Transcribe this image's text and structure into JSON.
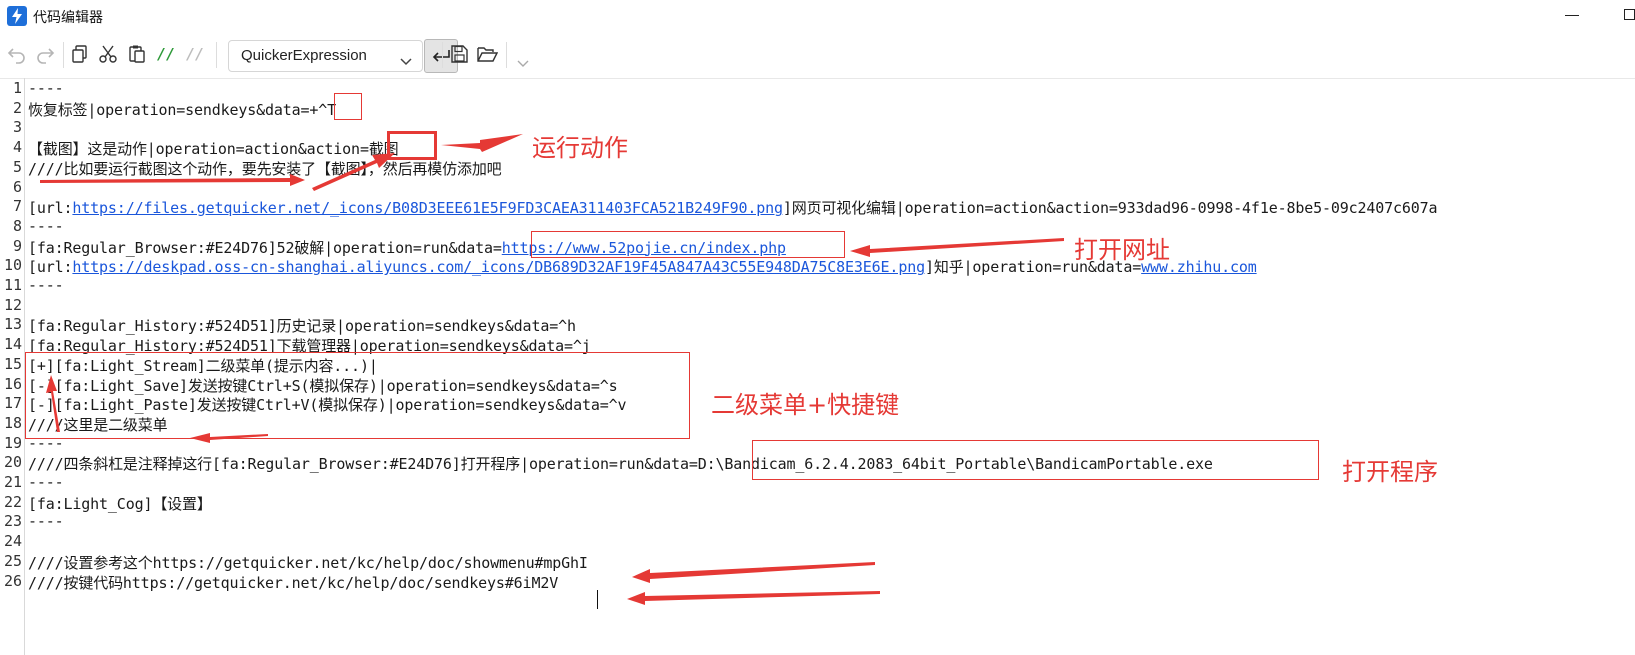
{
  "window": {
    "title": "代码编辑器"
  },
  "toolbar": {
    "buttons": [
      "undo-icon",
      "redo-icon",
      "copy-icon",
      "cut-icon",
      "paste-icon",
      "comment-icon",
      "uncomment-icon",
      "word-wrap-icon",
      "save-icon",
      "open-folder-icon",
      "chevron-down-icon"
    ],
    "comment_glyph": "//",
    "uncomment_glyph": "//",
    "language_select": {
      "value": "QuickerExpression"
    }
  },
  "editor": {
    "line_numbers": [
      "1",
      "2",
      "3",
      "4",
      "5",
      "6",
      "7",
      "8",
      "9",
      "10",
      "11",
      "12",
      "13",
      "14",
      "15",
      "16",
      "17",
      "18",
      "19",
      "20",
      "21",
      "22",
      "23",
      "24",
      "25",
      "26"
    ],
    "lines": [
      {
        "text": "----"
      },
      {
        "text": "恢复标签|operation=sendkeys&data=+^T"
      },
      {
        "text": ""
      },
      {
        "text": "【截图】这是动作|operation=action&action=截图"
      },
      {
        "text": "////比如要运行截图这个动作，要先安装了【截图】，然后再模仿添加吧"
      },
      {
        "text": ""
      },
      {
        "pre": "[url:",
        "link": "https://files.getquicker.net/_icons/B08D3EEE61E5F9FD3CAEA311403FCA521B249F90.png",
        "post": "]网页可视化编辑|operation=action&action=933dad96-0998-4f1e-8be5-09c2407c607a"
      },
      {
        "text": "----"
      },
      {
        "pre": "[fa:Regular_Browser:#E24D76]52破解|operation=run&data=",
        "link": "https://www.52pojie.cn/index.php",
        "post": ""
      },
      {
        "pre": "[url:",
        "link": "https://deskpad.oss-cn-shanghai.aliyuncs.com/_icons/DB689D32AF19F45A847A43C55E948DA75C8E3E6E.png",
        "post": "]知乎|operation=run&data=",
        "link2": "www.zhihu.com"
      },
      {
        "text": "----"
      },
      {
        "text": ""
      },
      {
        "text": "[fa:Regular_History:#524D51]历史记录|operation=sendkeys&data=^h"
      },
      {
        "text": "[fa:Regular_History:#524D51]下载管理器|operation=sendkeys&data=^j"
      },
      {
        "text": "[+][fa:Light_Stream]二级菜单(提示内容...)|"
      },
      {
        "text": "[-][fa:Light_Save]发送按键Ctrl+S(模拟保存)|operation=sendkeys&data=^s"
      },
      {
        "text": "[-][fa:Light_Paste]发送按键Ctrl+V(模拟保存)|operation=sendkeys&data=^v"
      },
      {
        "text": "////这里是二级菜单"
      },
      {
        "text": "----"
      },
      {
        "text": "////四条斜杠是注释掉这行[fa:Regular_Browser:#E24D76]打开程序|operation=run&data=D:\\Bandicam_6.2.4.2083_64bit_Portable\\BandicamPortable.exe"
      },
      {
        "text": "----"
      },
      {
        "text": "[fa:Light_Cog]【设置】"
      },
      {
        "text": "----"
      },
      {
        "text": ""
      },
      {
        "text": "////设置参考这个https://getquicker.net/kc/help/doc/showmenu#mpGhI"
      },
      {
        "text": "////按键代码https://getquicker.net/kc/help/doc/sendkeys#6iM2V"
      }
    ]
  },
  "annotations": {
    "run_action": "运行动作",
    "open_url": "打开网址",
    "submenu": "二级菜单+快捷键",
    "open_program": "打开程序",
    "color": "#e53935"
  },
  "colors": {
    "link": "#1a56db",
    "annotation": "#e53935",
    "accent": "#1e6fd9"
  }
}
